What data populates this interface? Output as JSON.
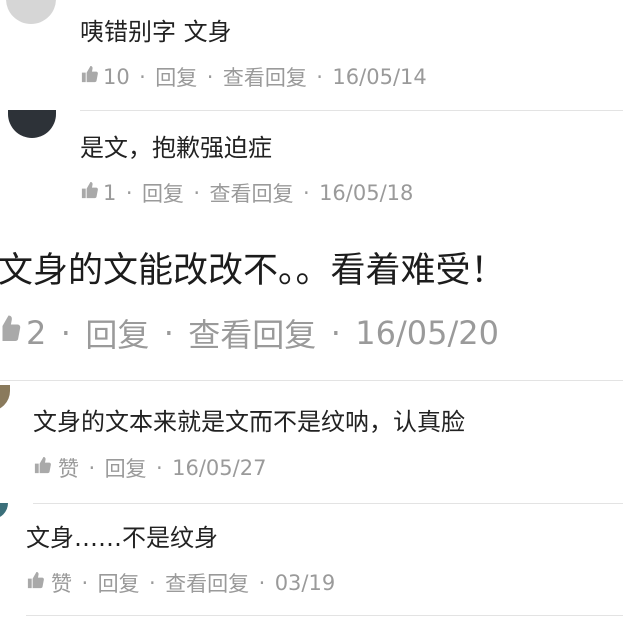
{
  "separator": "·",
  "comments": [
    {
      "text": "咦错别字 文身",
      "likes": "10",
      "reply": "回复",
      "view_replies": "查看回复",
      "date": "16/05/14"
    },
    {
      "text": "是文，抱歉强迫症",
      "likes": "1",
      "reply": "回复",
      "view_replies": "查看回复",
      "date": "16/05/18"
    },
    {
      "text": "文身的文能改改不。。看着难受！",
      "likes": "2",
      "reply": "回复",
      "view_replies": "查看回复",
      "date": "16/05/20"
    },
    {
      "text": "文身的文本来就是文而不是纹呐，认真脸",
      "likes": "赞",
      "reply": "回复",
      "date": "16/05/27"
    },
    {
      "text": "文身……不是纹身",
      "likes": "赞",
      "reply": "回复",
      "view_replies": "查看回复",
      "date": "03/19"
    }
  ],
  "colors": {
    "text": "#222222",
    "meta": "#9a9a9a",
    "divider": "#e3e3e3"
  },
  "icons": {
    "like": "thumbs-up-icon"
  }
}
